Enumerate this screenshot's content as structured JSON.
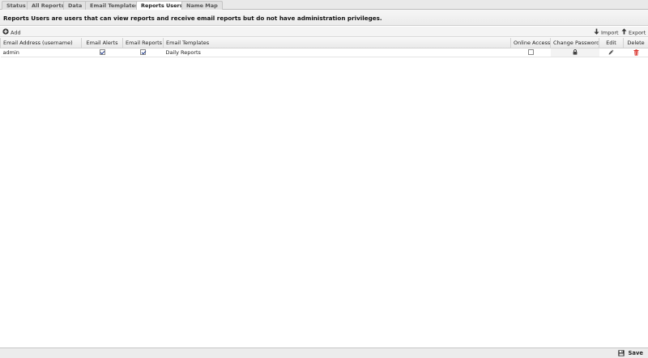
{
  "tabs": [
    {
      "label": "Status"
    },
    {
      "label": "All Reports"
    },
    {
      "label": "Data"
    },
    {
      "label": "Email Templates"
    },
    {
      "label": "Reports Users"
    },
    {
      "label": "Name Map"
    }
  ],
  "active_tab": "Reports Users",
  "description": "Reports Users are users that can view reports and receive email reports but do not have administration privileges.",
  "toolbar": {
    "add_label": "Add",
    "import_label": "Import",
    "export_label": "Export"
  },
  "table": {
    "headers": {
      "email": "Email Address (username)",
      "email_alerts": "Email Alerts",
      "email_reports": "Email Reports",
      "email_templates": "Email Templates",
      "online_access": "Online Access",
      "change_password": "Change Password",
      "edit": "Edit",
      "delete": "Delete"
    },
    "rows": [
      {
        "email": "admin",
        "email_alerts": true,
        "email_reports": true,
        "email_templates": "Daily Reports",
        "online_access": false
      }
    ]
  },
  "footer": {
    "save_label": "Save"
  },
  "colors": {
    "delete_icon": "#d9322b",
    "checkmark": "#1f3a8a"
  }
}
